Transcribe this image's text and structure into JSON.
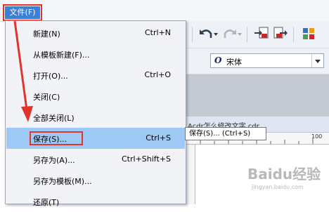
{
  "menubar": {
    "file_label": "文件(F)"
  },
  "file_menu": {
    "items": [
      {
        "label": "新建(N)",
        "shortcut": "Ctrl+N"
      },
      {
        "label": "从模板新建(F)...",
        "shortcut": ""
      },
      {
        "label": "打开(O)...",
        "shortcut": "Ctrl+O"
      },
      {
        "label": "关闭(C)",
        "shortcut": ""
      },
      {
        "label": "全部关闭(L)",
        "shortcut": ""
      },
      {
        "label": "保存(S)...",
        "shortcut": "Ctrl+S"
      },
      {
        "label": "另存为(A)...",
        "shortcut": "Ctrl+Shift+S"
      },
      {
        "label": "另存为模板(M)...",
        "shortcut": ""
      },
      {
        "label": "还原(T)",
        "shortcut": ""
      }
    ]
  },
  "toolbar": {
    "font_name": "宋体",
    "font_icon_glyph": "O"
  },
  "document": {
    "tab_title": "Acdr怎么修改文字.cdr",
    "ruler_label": "100"
  },
  "tooltip": {
    "text": "保存(S)... (Ctrl+S)"
  },
  "watermark": {
    "logo": "Baidu经验",
    "url": "jingyan.baidu.com"
  },
  "colors": {
    "highlight": "#9ec9f5",
    "annotation_red": "#e0342c",
    "menu_blue": "#3c7fd4"
  }
}
